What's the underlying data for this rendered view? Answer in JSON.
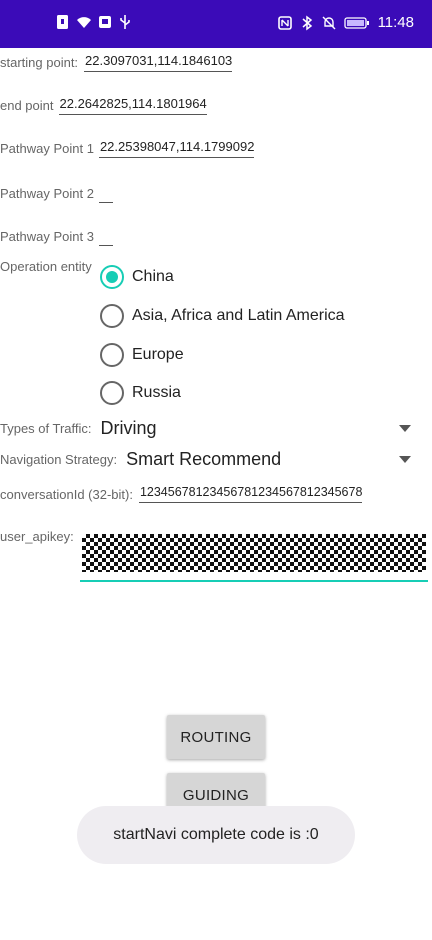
{
  "status_bar": {
    "time": "11:48",
    "bg_color": "#3b0bb8",
    "left_icons": [
      "sim-icon",
      "wifi-icon",
      "app-icon",
      "usb-icon"
    ],
    "right_icons": [
      "nfc-icon",
      "bluetooth-icon",
      "mute-icon",
      "battery-icon"
    ]
  },
  "form": {
    "starting_point": {
      "label": "starting point:",
      "value": "22.3097031,114.1846103"
    },
    "end_point": {
      "label": "end point",
      "value": "22.2642825,114.1801964"
    },
    "pathway_point_1": {
      "label": "Pathway Point 1",
      "value": "22.25398047,114.1799092"
    },
    "pathway_point_2": {
      "label": "Pathway Point 2",
      "value": ""
    },
    "pathway_point_3": {
      "label": "Pathway Point 3",
      "value": ""
    },
    "operation_entity": {
      "label": "Operation entity",
      "options": [
        "China",
        "Asia, Africa and Latin America",
        "Europe",
        "Russia"
      ],
      "selected": "China"
    },
    "types_of_traffic": {
      "label": "Types of Traffic:",
      "value": "Driving"
    },
    "navigation_strategy": {
      "label": "Navigation Strategy:",
      "value": "Smart Recommend"
    },
    "conversation_id": {
      "label": "conversationId (32-bit):",
      "value": "12345678123456781234567812345678"
    },
    "user_apikey": {
      "label": "user_apikey:"
    }
  },
  "buttons": {
    "routing": "ROUTING",
    "guiding": "GUIDING"
  },
  "toast": {
    "message": "startNavi complete code is :0"
  },
  "colors": {
    "accent": "#17cdb5",
    "button_bg": "#d6d6d6",
    "toast_bg": "#efedf1"
  }
}
